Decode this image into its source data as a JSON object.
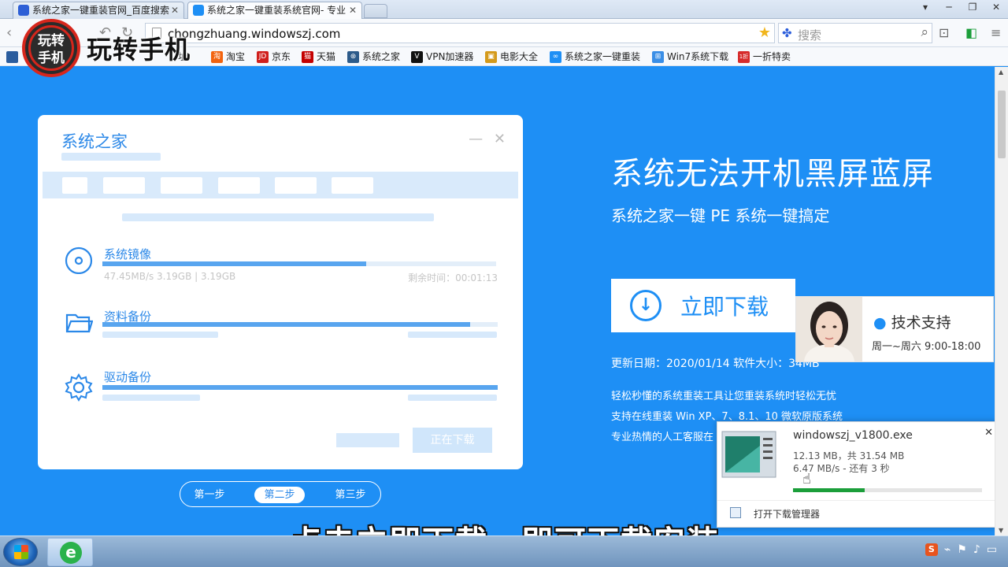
{
  "browser": {
    "tabs": [
      {
        "title": "系统之家一键重装官网_百度搜索",
        "favicon_color": "#2d5fd6"
      },
      {
        "title": "系统之家一键重装系统官网- 专业",
        "favicon_color": "#1e8ff5"
      }
    ],
    "window_controls": [
      "▾",
      "─",
      "❐",
      "✕"
    ],
    "url": "chongzhuang.windowszj.com",
    "search_placeholder": "搜索",
    "bookmarks": [
      {
        "label": "址",
        "color": "#e04b2c",
        "glyph": ""
      },
      {
        "label": "淘宝",
        "color": "#f2630f",
        "glyph": "淘"
      },
      {
        "label": "京东",
        "color": "#d0201d",
        "glyph": "JD"
      },
      {
        "label": "天猫",
        "color": "#c40000",
        "glyph": "猫"
      },
      {
        "label": "系统之家",
        "color": "#2d5b8a",
        "glyph": "⊛"
      },
      {
        "label": "VPN加速器",
        "color": "#111111",
        "glyph": "V"
      },
      {
        "label": "电影大全",
        "color": "#d49a1c",
        "glyph": "▣"
      },
      {
        "label": "系统之家一键重装",
        "color": "#1e8ff5",
        "glyph": "∞"
      },
      {
        "label": "Win7系统下载",
        "color": "#3a8ee6",
        "glyph": "⊞"
      },
      {
        "label": "一折特卖",
        "color": "#d62b2b",
        "glyph": "1折"
      }
    ]
  },
  "watermark": {
    "badge_line1": "玩转",
    "badge_line2": "手机",
    "text": "玩转手机"
  },
  "installer": {
    "brand": "系统之家",
    "window_controls": {
      "minimize": "—",
      "close": "✕"
    },
    "rows": [
      {
        "label": "系统镜像",
        "progress": 0.67,
        "meta_left": "47.45MB/s  3.19GB | 3.19GB",
        "meta_right": "剩余时间：00:01:13",
        "icon": "disc-icon"
      },
      {
        "label": "资料备份",
        "progress": 0.93,
        "meta_left": "",
        "meta_right": "",
        "icon": "folder-icon"
      },
      {
        "label": "驱动备份",
        "progress": 1.0,
        "meta_left": "",
        "meta_right": "",
        "icon": "gear-icon"
      }
    ],
    "download_button": "正在下载",
    "steps": [
      "第一步",
      "第二步",
      "第三步"
    ],
    "active_step": 1
  },
  "hero": {
    "title": "系统无法开机黑屏蓝屏",
    "subtitle": "系统之家一键 PE 系统一键搞定",
    "download_label": "立即下载",
    "update_info": "更新日期：2020/01/14   软件大小：34MB",
    "features": [
      "轻松秒懂的系统重装工具让您重装系统时轻松无忧",
      "支持在线重装 Win XP、7、8.1、10 微软原版系统",
      "专业热情的人工客服在"
    ]
  },
  "support": {
    "title": "技术支持",
    "hours": "周一~周六 9:00-18:00"
  },
  "download_popup": {
    "filename": "windowszj_v1800.exe",
    "size": "12.13 MB，共 31.54 MB",
    "speed": "6.47 MB/s - 还有 3 秒",
    "progress": 0.38,
    "manager": "打开下载管理器",
    "close": "✕"
  },
  "caption": "点击立即下载，即可下载安装",
  "colors": {
    "page_bg": "#1e8ff5",
    "accent": "#2b88e8",
    "progress_green": "#1b9e3a"
  }
}
